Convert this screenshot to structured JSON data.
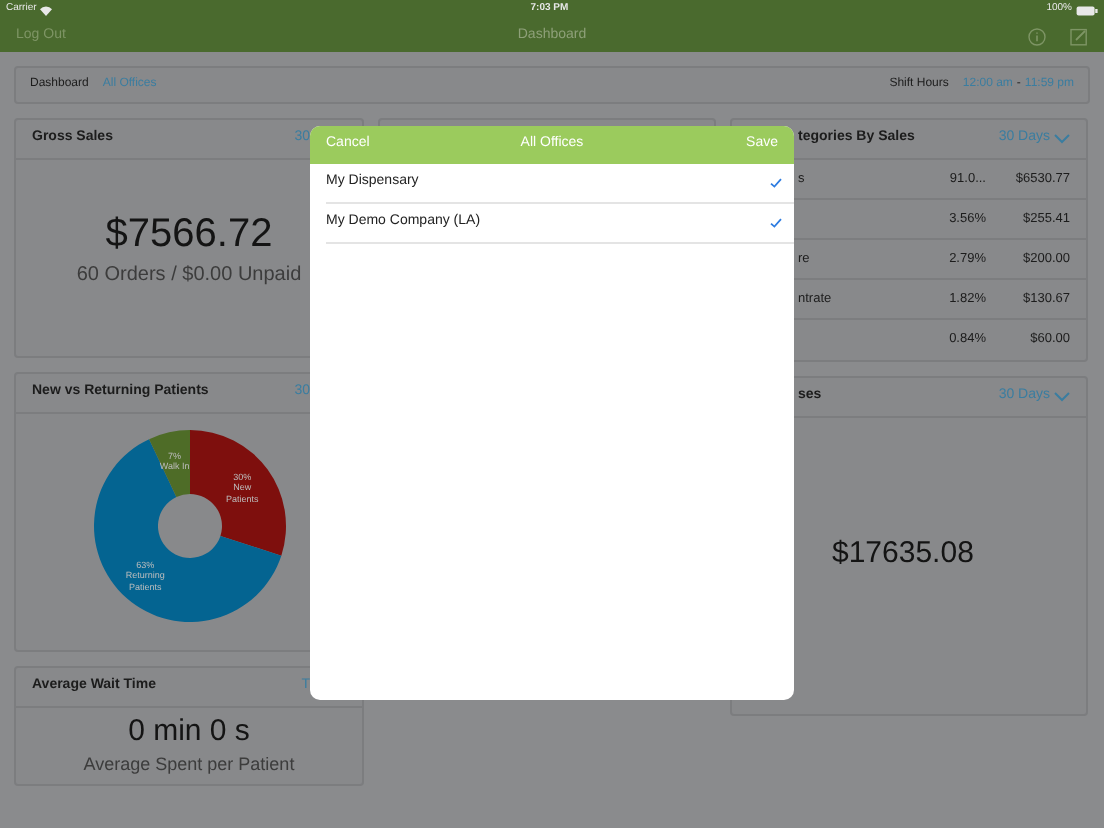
{
  "status_bar": {
    "carrier": "Carrier",
    "time": "7:03 PM",
    "battery": "100%"
  },
  "nav_bar": {
    "left_button": "Log Out",
    "title": "Dashboard"
  },
  "filter_bar": {
    "label": "Dashboard",
    "offices_link": "All Offices",
    "shift_label": "Shift Hours",
    "shift_start": "12:00 am",
    "separator": "-",
    "shift_end": "11:59 pm"
  },
  "gross_sales": {
    "title": "Gross Sales",
    "range": "30",
    "amount": "$7566.72",
    "subtitle": "60 Orders / $0.00 Unpaid"
  },
  "patients": {
    "title": "New vs Returning Patients",
    "range": "30",
    "chart_data": {
      "type": "donut",
      "categories": [
        "New Patients",
        "Returning Patients",
        "Walk In"
      ],
      "values": [
        30,
        63,
        7
      ],
      "colors": [
        "#7e0f0d",
        "#046491",
        "#4e6c27"
      ],
      "value_labels": [
        "30%",
        "63%",
        "7%"
      ]
    }
  },
  "wait_time": {
    "title": "Average Wait Time",
    "range": "T",
    "value": "0 min 0 s",
    "subtitle": "Average Spent per Patient"
  },
  "categories": {
    "title": "tegories By Sales",
    "range": "30 Days",
    "rows": [
      {
        "label": "s",
        "percent": "91.0...",
        "amount": "$6530.77"
      },
      {
        "percent": "3.56%",
        "amount": "$255.41"
      },
      {
        "label": "re",
        "percent": "2.79%",
        "amount": "$200.00"
      },
      {
        "label": "ntrate",
        "percent": "1.82%",
        "amount": "$130.67"
      },
      {
        "percent": "0.84%",
        "amount": "$60.00"
      }
    ]
  },
  "expenses": {
    "title": "ses",
    "range": "30 Days",
    "amount": "$17635.08"
  },
  "modal": {
    "cancel": "Cancel",
    "title": "All Offices",
    "save": "Save",
    "offices": [
      {
        "name": "My Dispensary",
        "selected": true
      },
      {
        "name": "My Demo Company (LA)",
        "selected": true
      }
    ]
  }
}
